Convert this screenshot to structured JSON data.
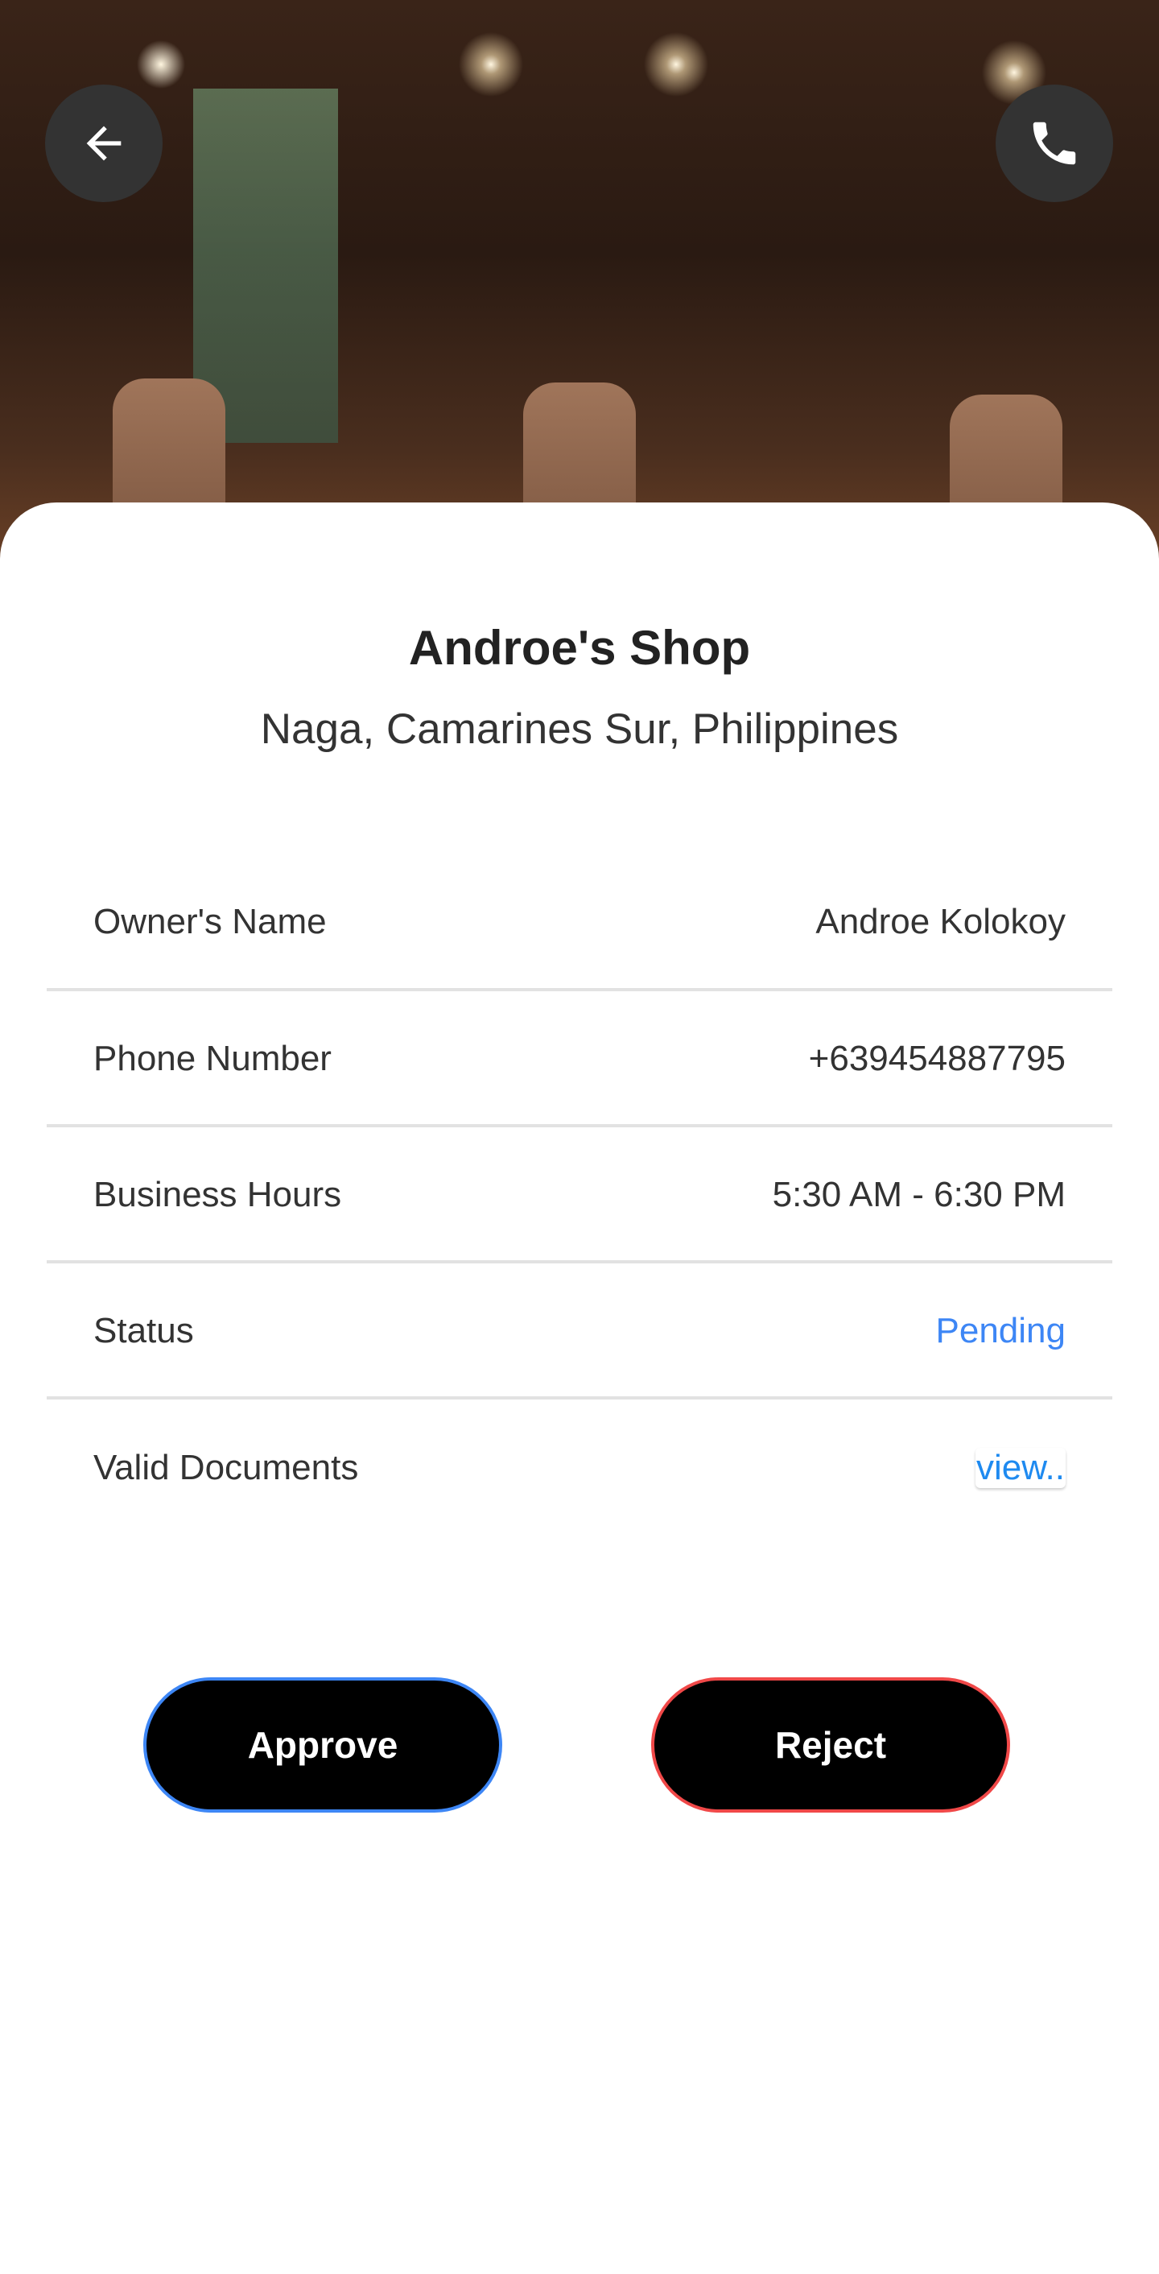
{
  "header": {
    "back_icon": "arrow-left-icon",
    "call_icon": "phone-icon"
  },
  "shop": {
    "name": "Androe's Shop",
    "location": "Naga, Camarines Sur, Philippines"
  },
  "details": [
    {
      "label": "Owner's Name",
      "value": "Androe Kolokoy"
    },
    {
      "label": "Phone Number",
      "value": "+639454887795"
    },
    {
      "label": "Business Hours",
      "value": "5:30 AM - 6:30 PM"
    },
    {
      "label": "Status",
      "value": "Pending",
      "color": "#3d86f5"
    },
    {
      "label": "Valid Documents",
      "value": "view..",
      "color": "#1e8af0"
    }
  ],
  "actions": {
    "approve_label": "Approve",
    "approve_border": "#3d86f5",
    "reject_label": "Reject",
    "reject_border": "#f04848"
  }
}
